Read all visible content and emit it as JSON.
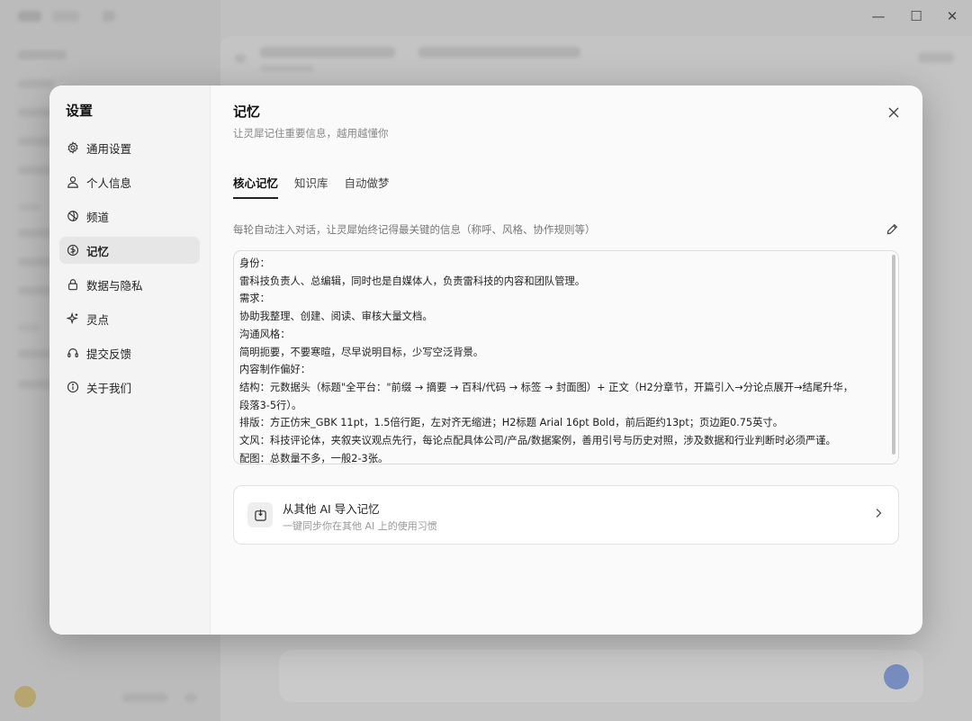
{
  "settings": {
    "title": "设置",
    "nav": [
      {
        "label": "通用设置",
        "icon": "gear-icon"
      },
      {
        "label": "个人信息",
        "icon": "user-icon"
      },
      {
        "label": "频道",
        "icon": "channel-icon"
      },
      {
        "label": "记忆",
        "icon": "memory-icon",
        "active": true
      },
      {
        "label": "数据与隐私",
        "icon": "lock-icon"
      },
      {
        "label": "灵点",
        "icon": "sparkle-icon"
      },
      {
        "label": "提交反馈",
        "icon": "feedback-icon"
      },
      {
        "label": "关于我们",
        "icon": "info-icon"
      }
    ]
  },
  "memory": {
    "title": "记忆",
    "subtitle": "让灵犀记住重要信息，越用越懂你",
    "tabs": [
      "核心记忆",
      "知识库",
      "自动做梦"
    ],
    "description": "每轮自动注入对话，让灵犀始终记得最关键的信息（称呼、风格、协作规则等）",
    "lines": [
      "身份：",
      "雷科技负责人、总编辑，同时也是自媒体人，负责雷科技的内容和团队管理。",
      "需求：",
      "协助我整理、创建、阅读、审核大量文档。",
      "沟通风格：",
      "简明扼要，不要寒暄，尽早说明目标，少写空泛背景。",
      "内容制作偏好：",
      "结构：元数据头（标题\"全平台：\"前缀 → 摘要 → 百科/代码 → 标签 → 封面图）+ 正文（H2分章节，开篇引入→分论点展开→结尾升华，",
      "段落3-5行）。",
      "排版：方正仿宋_GBK 11pt，1.5倍行距，左对齐无缩进；H2标题 Arial 16pt Bold，前后距约13pt；页边距0.75英寸。",
      "文风：科技评论体，夹叙夹议观点先行，每论点配具体公司/产品/数据案例，善用引号与历史对照，涉及数据和行业判断时必须严谨。",
      "配图：总数量不多，一般2-3张。"
    ],
    "import": {
      "title": "从其他 AI 导入记忆",
      "subtitle": "一键同步你在其他 AI 上的使用习惯"
    }
  },
  "window_controls": {
    "minimize": "—",
    "maximize": "☐",
    "close": "✕"
  }
}
